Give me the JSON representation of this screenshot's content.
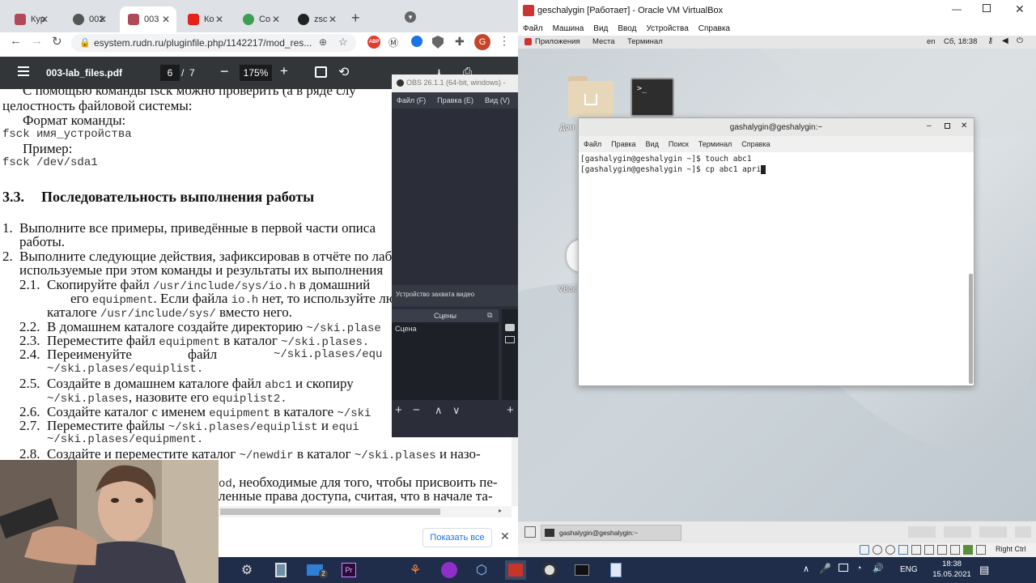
{
  "chrome": {
    "tabs": [
      {
        "label": "Кур",
        "color": "#b04a5a"
      },
      {
        "label": "002",
        "color": "#555555"
      },
      {
        "label": "003",
        "color": "#b04a5a"
      },
      {
        "label": "Ко",
        "color": "#e62117"
      },
      {
        "label": "Co",
        "color": "#3c9e50"
      },
      {
        "label": "zsc",
        "color": "#222222"
      }
    ],
    "new_tab": "+",
    "url": "esystem.rudn.ru/pluginfile.php/1142217/mod_res...",
    "profile_initial": "G",
    "abp_label": "ABP"
  },
  "pdf": {
    "filename": "003-lab_files.pdf",
    "page_current": "6",
    "page_sep": "/",
    "page_total": "7",
    "zoom": "175%",
    "lines": {
      "l0": "С помощью команды fsck можно проверить (а в ряде слу",
      "l1": "целостность файловой системы:",
      "l2": "Формат команды:",
      "l3": "fsck имя_устройства",
      "l4": "Пример:",
      "l5": "fsck /dev/sda1",
      "h_num": "3.3.",
      "h_text": "Последовательность выполнения работы",
      "i1_num": "1.",
      "i1a": "Выполните все примеры, приведённые в первой части описа",
      "i1b": "работы.",
      "i2_num": "2.",
      "i2a": "Выполните следующие действия, зафиксировав в отчёте по лаб",
      "i2b": "используемые при этом команды и результаты их выполнения",
      "s21_num": "2.1.",
      "s21a1": "Скопируйте файл ",
      "s21a2": "/usr/include/sys/io.h",
      "s21a3": " в домашний",
      "s21b1": "его ",
      "s21b2": "equipment",
      "s21b3": ". Если файла ",
      "s21b4": "io.h",
      "s21b5": " нет, то используйте лю",
      "s21c1": "каталоге ",
      "s21c2": "/usr/include/sys/",
      "s21c3": " вместо него.",
      "s22_num": "2.2.",
      "s22a": "В домашнем каталоге создайте директорию ",
      "s22b": "~/ski.plase",
      "s23_num": "2.3.",
      "s23a": "Переместите файл ",
      "s23b": "equipment",
      "s23c": " в каталог ",
      "s23d": "~/ski.plases.",
      "s24_num": "2.4.",
      "s24a": "Переименуйте",
      "s24b": "файл",
      "s24c": "~/ski.plases/equ",
      "s24d": "~/ski.plases/equiplist.",
      "s25_num": "2.5.",
      "s25a1": "Создайте в домашнем каталоге файл ",
      "s25a2": "abc1",
      "s25a3": " и скопиру",
      "s25b1": "~/ski.plases",
      "s25b2": ", назовите его ",
      "s25b3": "equiplist2.",
      "s26_num": "2.6.",
      "s26a": "Создайте каталог с именем ",
      "s26b": "equipment",
      "s26c": " в каталоге ",
      "s26d": "~/ski",
      "s27_num": "2.7.",
      "s27a": "Переместите файлы ",
      "s27b": "~/ski.plases/equiplist",
      "s27c": " и ",
      "s27d": "equi",
      "s27e": "~/ski.plases/equipment.",
      "s28_num": "2.8.",
      "s28a": "Создайте и переместите каталог ",
      "s28b": "~/newdir",
      "s28c": " в каталог ",
      "s28d": "~/ski.plases",
      "s28e": " и назо-",
      "p1a": "od",
      "p1b": ", необходимые для того, чтобы присвоить пе-",
      "p2": "ленные права доступа, считая, что в начале та-"
    },
    "notif_button": "Показать все"
  },
  "obs": {
    "title": "OBS 26.1.1 (64-bit, windows) -",
    "menu": [
      "Файл (F)",
      "Правка (E)",
      "Вид (V)"
    ],
    "source_label": "Устройство захвата видео",
    "scenes_header": "Сцены",
    "scene_item": "Сцена"
  },
  "vbox": {
    "title": "geschalygin [Работает] - Oracle VM VirtualBox",
    "menu": [
      "Файл",
      "Машина",
      "Вид",
      "Ввод",
      "Устройства",
      "Справка"
    ],
    "gnome": {
      "apps": "Приложения",
      "places": "Места",
      "terminal": "Терминал",
      "lang": "en",
      "clock": "Сб, 18:38"
    },
    "desktop_labels": [
      "Дом",
      "VBox"
    ],
    "terminal": {
      "title": "gashalygin@geshalygin:~",
      "menu": [
        "Файл",
        "Правка",
        "Вид",
        "Поиск",
        "Терминал",
        "Справка"
      ],
      "line1": "[gashalygin@geshalygin ~]$ touch abc1",
      "line2": "[gashalygin@geshalygin ~]$ cp abc1 apri"
    },
    "guest_taskbar_item": "gashalygin@geshalygin:~",
    "host_key": "Right Ctrl"
  },
  "taskbar": {
    "lang": "ENG",
    "time": "18:38",
    "date": "15.05.2021",
    "badge": "2"
  }
}
